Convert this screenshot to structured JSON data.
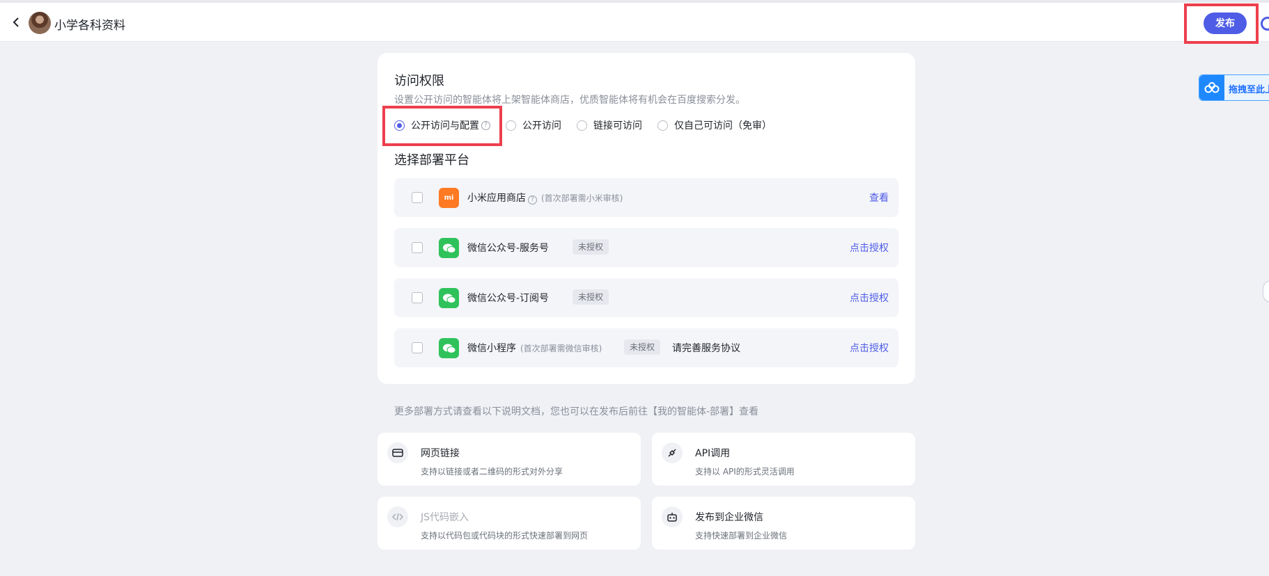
{
  "header": {
    "app_title": "小学各科资料",
    "publish_label": "发布"
  },
  "drag_widget": {
    "label": "拖拽至此上"
  },
  "access": {
    "title": "访问权限",
    "description": "设置公开访问的智能体将上架智能体商店，优质智能体将有机会在百度搜索分发。",
    "options": [
      {
        "label": "公开访问与配置",
        "selected": true,
        "has_help": true
      },
      {
        "label": "公开访问",
        "selected": false
      },
      {
        "label": "链接可访问",
        "selected": false
      },
      {
        "label": "仅自己可访问（免审）",
        "selected": false
      }
    ]
  },
  "platforms": {
    "title": "选择部署平台",
    "items": [
      {
        "name": "小米应用商店",
        "note": "(首次部署需小米审核)",
        "badge": "",
        "extra": "",
        "action": "查看",
        "icon": "mi",
        "icon_text": "mi"
      },
      {
        "name": "微信公众号-服务号",
        "note": "",
        "badge": "未授权",
        "extra": "",
        "action": "点击授权",
        "icon": "wechat"
      },
      {
        "name": "微信公众号-订阅号",
        "note": "",
        "badge": "未授权",
        "extra": "",
        "action": "点击授权",
        "icon": "wechat"
      },
      {
        "name": "微信小程序",
        "note": "(首次部署需微信审核)",
        "badge": "未授权",
        "extra": "请完善服务协议",
        "action": "点击授权",
        "icon": "wechat"
      }
    ]
  },
  "more": {
    "description": "更多部署方式请查看以下说明文档，您也可以在发布后前往【我的智能体-部署】查看",
    "cards": [
      {
        "title": "网页链接",
        "desc": "支持以链接或者二维码的形式对外分享",
        "icon": "card-icon"
      },
      {
        "title": "API调用",
        "desc": "支持以 API的形式灵活调用",
        "icon": "plug-icon"
      },
      {
        "title": "JS代码嵌入",
        "desc": "支持以代码包或代码块的形式快速部署到网页",
        "icon": "code-icon"
      },
      {
        "title": "发布到企业微信",
        "desc": "支持快速部署到企业微信",
        "icon": "robot-icon"
      }
    ]
  },
  "colors": {
    "accent": "#4e5ce6",
    "highlight": "#ee3f4d",
    "wechat": "#2fc25b",
    "xiaomi": "#ff7a22"
  }
}
